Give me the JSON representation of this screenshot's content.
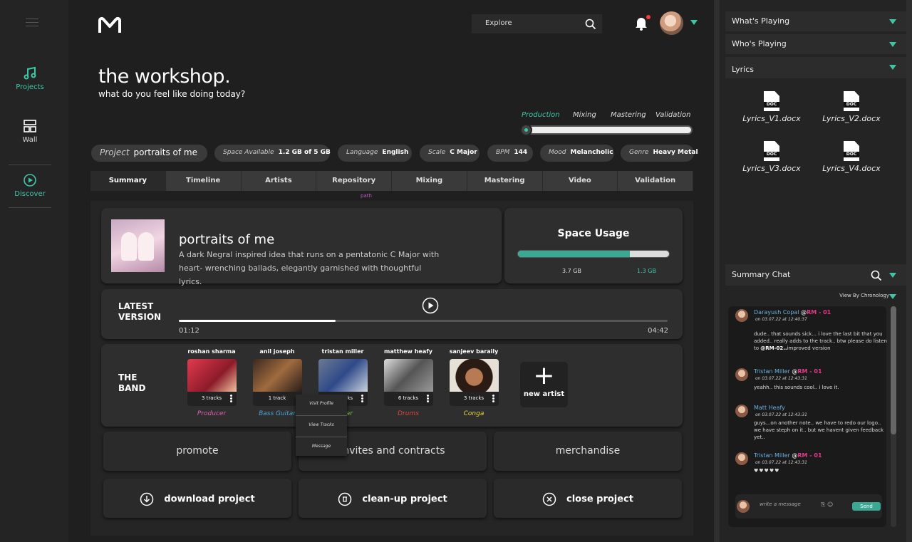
{
  "nav": {
    "items": [
      {
        "label": "Projects"
      },
      {
        "label": "Wall"
      },
      {
        "label": "Discover"
      }
    ]
  },
  "header": {
    "search_placeholder": "Explore"
  },
  "workshop": {
    "title": "the workshop.",
    "subtitle": "what do you feel like doing today?"
  },
  "stages": {
    "items": [
      "Production",
      "Mixing",
      "Mastering",
      "Validation"
    ],
    "current": "Production"
  },
  "project_info": {
    "project_label": "Project",
    "project_value": "portraits of me",
    "space_label": "Space Available",
    "space_value": "1.2 GB of 5 GB",
    "language_label": "Language",
    "language_value": "English",
    "scale_label": "Scale",
    "scale_value": "C Major",
    "bpm_label": "BPM",
    "bpm_value": "144",
    "mood_label": "Mood",
    "mood_value": "Melancholic",
    "genre_label": "Genre",
    "genre_value": "Heavy Metal"
  },
  "tabs": {
    "items": [
      "Summary",
      "Timeline",
      "Artists",
      "Repository",
      "Mixing",
      "Mastering",
      "Video",
      "Validation"
    ],
    "active": "Summary",
    "hint": "path"
  },
  "summary": {
    "name": "portraits of me",
    "description": "A dark Negral inspired idea that runs on a pentatonic C Major with heart- wrenching ballads, elegantly garnished with thoughtful lyrics."
  },
  "space_usage": {
    "title": "Space Usage",
    "used": "3.7 GB",
    "free": "1.3 GB",
    "used_fraction": 0.74
  },
  "latest_version": {
    "label_line1": "LATEST",
    "label_line2": "VERSION",
    "current_time": "01:12",
    "total_time": "04:42",
    "progress_fraction": 0.32
  },
  "band": {
    "label_line1": "THE",
    "label_line2": "BAND",
    "members": [
      {
        "name": "roshan sharma",
        "tracks": "3 tracks",
        "role": "Producer",
        "role_color": "#e05fb0"
      },
      {
        "name": "anil joseph",
        "tracks": "1 track",
        "role": "Bass Guitar",
        "role_color": "#4aa3d8"
      },
      {
        "name": "tristan miller",
        "tracks": "3 tracks",
        "role": "Guitar",
        "role_color": "#7bc44a"
      },
      {
        "name": "matthew heafy",
        "tracks": "6 tracks",
        "role": "Drums",
        "role_color": "#e04545"
      },
      {
        "name": "sanjeev baraily",
        "tracks": "3 tracks",
        "role": "Conga",
        "role_color": "#e6d542"
      }
    ],
    "new_artist_label": "new artist",
    "context_menu": [
      "Visit Profile",
      "View Tracks",
      "Message"
    ]
  },
  "actions": {
    "promote": "promote",
    "invites": "invites and contracts",
    "merchandise": "merchandise",
    "download": "download project",
    "cleanup": "clean-up project",
    "close": "close project"
  },
  "right_panel": {
    "whats_playing": "What's Playing",
    "whos_playing": "Who's Playing",
    "lyrics": "Lyrics",
    "doc_badge": "DOC",
    "lyrics_files": [
      "Lyrics_V1.docx",
      "Lyrics_V2.docx",
      "Lyrics_V3.docx",
      "Lyrics_V4.docx"
    ],
    "chat_title": "Summary Chat",
    "chronology": "View By Chronology"
  },
  "chat": {
    "messages": [
      {
        "author": "Darayush Copal",
        "at": "@",
        "tag": "RM - 01",
        "when": "on 03.07.22 at 12:40:37",
        "text": "dude.. that sounds sick... i love the last bit that you added.. really adds to the track.. btw please do listen to",
        "mention": "@RM-02..",
        "text_after": "improved version"
      },
      {
        "author": "Tristan Miller",
        "at": "@",
        "tag": "RM - 01",
        "when": "on 03.07.22 at 12:43:31",
        "text": "yeahh.. this sounds cool.. i love it."
      },
      {
        "author": "Matt Heafy",
        "when": "on 03.07.22 at 12:43:31",
        "text": "guys...on another note.. we have to redo our logo.. we have steph on it.. but we havent given feedback yet.."
      },
      {
        "author": "Tristan Miller",
        "at": "@",
        "tag": "RM - 01",
        "when": "on 03.07.22 at 12:43:31",
        "hearts": "♥♥♥♥♥"
      }
    ],
    "input_placeholder": "write a message",
    "send_label": "Send"
  },
  "colors": {
    "accent": "#3dc7a6",
    "mention": "#e23a8a",
    "author": "#6ab0e0",
    "send": "#3aa893"
  }
}
